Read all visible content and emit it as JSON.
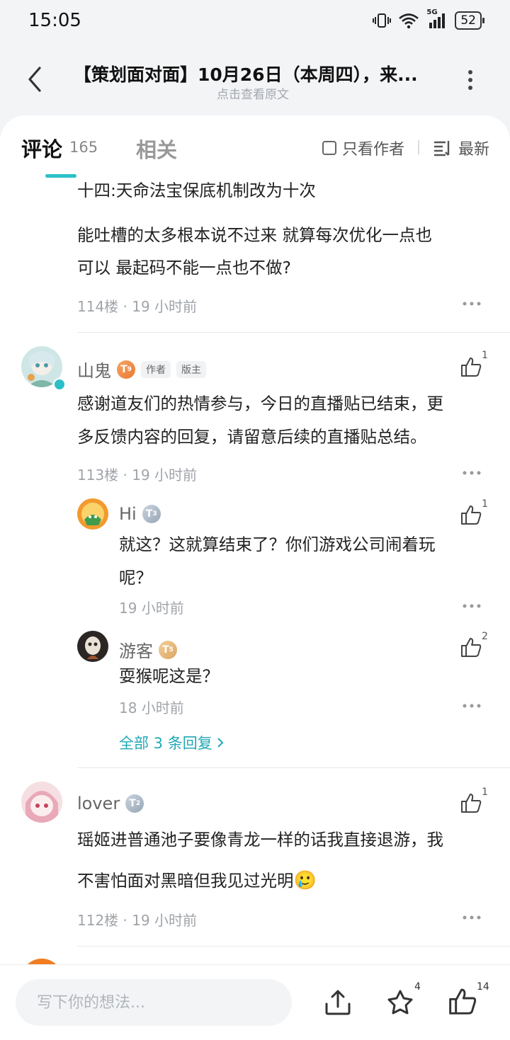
{
  "status_bar": {
    "time": "15:05",
    "network": "5G",
    "battery": "52"
  },
  "header": {
    "title": "【策划面对面】10月26日（本周四），来...",
    "subtitle": "点击查看原文"
  },
  "tabs": {
    "comments_label": "评论",
    "comments_count": "165",
    "related_label": "相关",
    "author_only_label": "只看作者",
    "sort_label": "最新"
  },
  "comments": [
    {
      "body_lines": [
        "十四:天命法宝保底机制改为十次",
        "能吐槽的太多根本说不过来   就算每次优化一点也",
        "可以  最起码不能一点也不做?"
      ],
      "meta": "114楼 · 19 小时前"
    },
    {
      "name": "山鬼",
      "level": "9",
      "tags": [
        "作者",
        "版主"
      ],
      "likes": "1",
      "body_lines": [
        "感谢道友们的热情参与，今日的直播贴已结束，更",
        "多反馈内容的回复，请留意后续的直播贴总结。"
      ],
      "meta": "113楼 · 19 小时前",
      "replies": [
        {
          "name": "Hi",
          "level": "3",
          "likes": "1",
          "body_lines": [
            "就这？这就算结束了？你们游戏公司闹着玩",
            "呢？"
          ],
          "meta": "19 小时前"
        },
        {
          "name": "游客",
          "level": "5",
          "likes": "2",
          "body_lines": [
            "耍猴呢这是？"
          ],
          "meta": "18 小时前"
        }
      ],
      "all_replies_label": "全部 3 条回复"
    },
    {
      "name": "lover",
      "level": "2",
      "likes": "1",
      "body_lines": [
        "瑶姬进普通池子要像青龙一样的话我直接退游，我",
        "不害怕面对黑暗但我见过光明"
      ],
      "emoji": "🥲",
      "meta": "112楼 · 19 小时前"
    }
  ],
  "bottom_bar": {
    "input_placeholder": "写下你的想法...",
    "favorite_count": "4",
    "like_count": "14"
  },
  "icons": [
    "vibrate-icon",
    "wifi-icon",
    "signal-icon",
    "battery-icon",
    "back-arrow-icon",
    "more-vertical-icon",
    "checkbox-icon",
    "sort-icon",
    "more-horizontal-icon",
    "thumbs-up-icon",
    "verified-icon",
    "chevron-right-icon",
    "share-icon",
    "star-icon"
  ],
  "colors": {
    "accent": "#2bbfc9",
    "link": "#21a9b6",
    "level_orange": "#e97b34"
  }
}
